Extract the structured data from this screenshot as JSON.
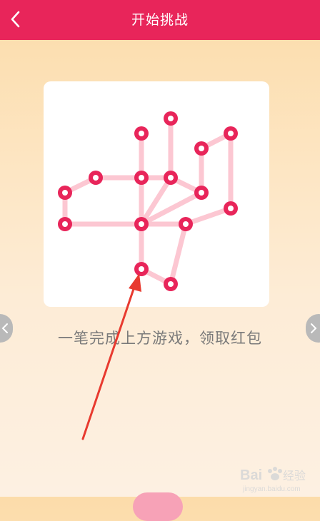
{
  "header": {
    "title": "开始挑战",
    "background": "#e8255a"
  },
  "icons": {
    "back": "chevron-left-icon",
    "prev": "chevron-left-icon",
    "next": "chevron-right-icon",
    "arrow": "annotation-arrow"
  },
  "puzzle": {
    "node_color": "#e8255a",
    "line_color": "#fcc7d2",
    "node_count": 15,
    "edge_count": 19
  },
  "instruction": "一笔完成上方游戏，领取红包",
  "annotation": {
    "arrow_color": "#e83a2f"
  },
  "watermark": {
    "brand_text": "Bai",
    "brand_suffix": "经验",
    "url": "jingyan.baidu.com"
  }
}
